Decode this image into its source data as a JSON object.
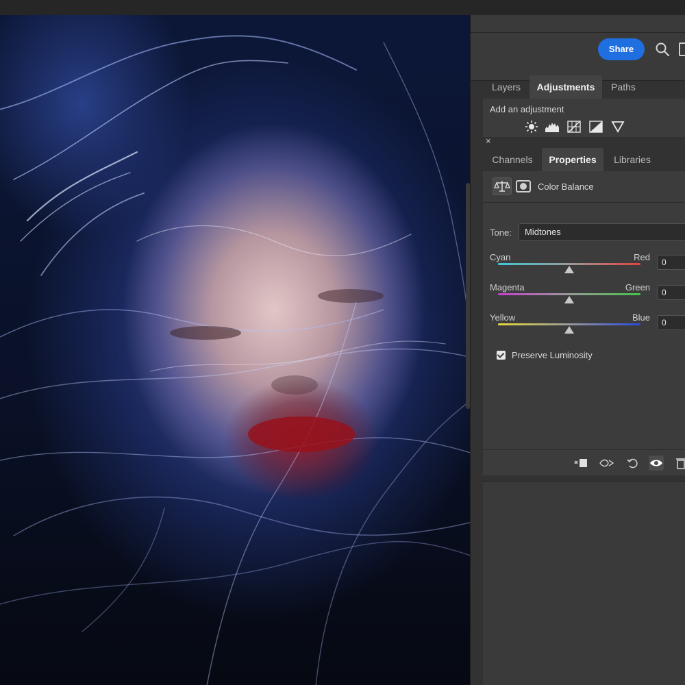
{
  "header": {
    "share_label": "Share"
  },
  "icons": {
    "search": "search-icon",
    "adjustment_icons": [
      "brightness-icon",
      "levels-icon",
      "curves-icon",
      "exposure-icon",
      "vibrance-icon"
    ],
    "properties_icons": [
      "color-balance-icon",
      "mask-icon"
    ],
    "footer_icons": [
      "clip-to-layer-icon",
      "view-previous-icon",
      "reset-icon",
      "visibility-icon",
      "delete-icon"
    ]
  },
  "top_tabs": [
    "Layers",
    "Adjustments",
    "Paths"
  ],
  "adjustments": {
    "title": "Add an adjustment"
  },
  "close_label": "×",
  "bottom_tabs": [
    "Channels",
    "Properties",
    "Libraries"
  ],
  "properties": {
    "title": "Color Balance",
    "tone_label": "Tone:",
    "tone_value": "Midtones",
    "sliders": [
      {
        "left": "Cyan",
        "right": "Red",
        "value": "0",
        "level": 0
      },
      {
        "left": "Magenta",
        "right": "Green",
        "value": "0",
        "level": 0
      },
      {
        "left": "Yellow",
        "right": "Blue",
        "value": "0",
        "level": 0
      }
    ],
    "preserve_luminosity": {
      "label": "Preserve Luminosity",
      "checked": true
    }
  },
  "colors": {
    "share_button": "#1f6fe0",
    "panel_bg": "#3c3c3c",
    "cyan_red": [
      "#3fc8d8",
      "#e0453a"
    ],
    "magenta_green": [
      "#c640d0",
      "#44c44a"
    ],
    "yellow_blue": [
      "#e6d83a",
      "#2a4ae0"
    ]
  }
}
